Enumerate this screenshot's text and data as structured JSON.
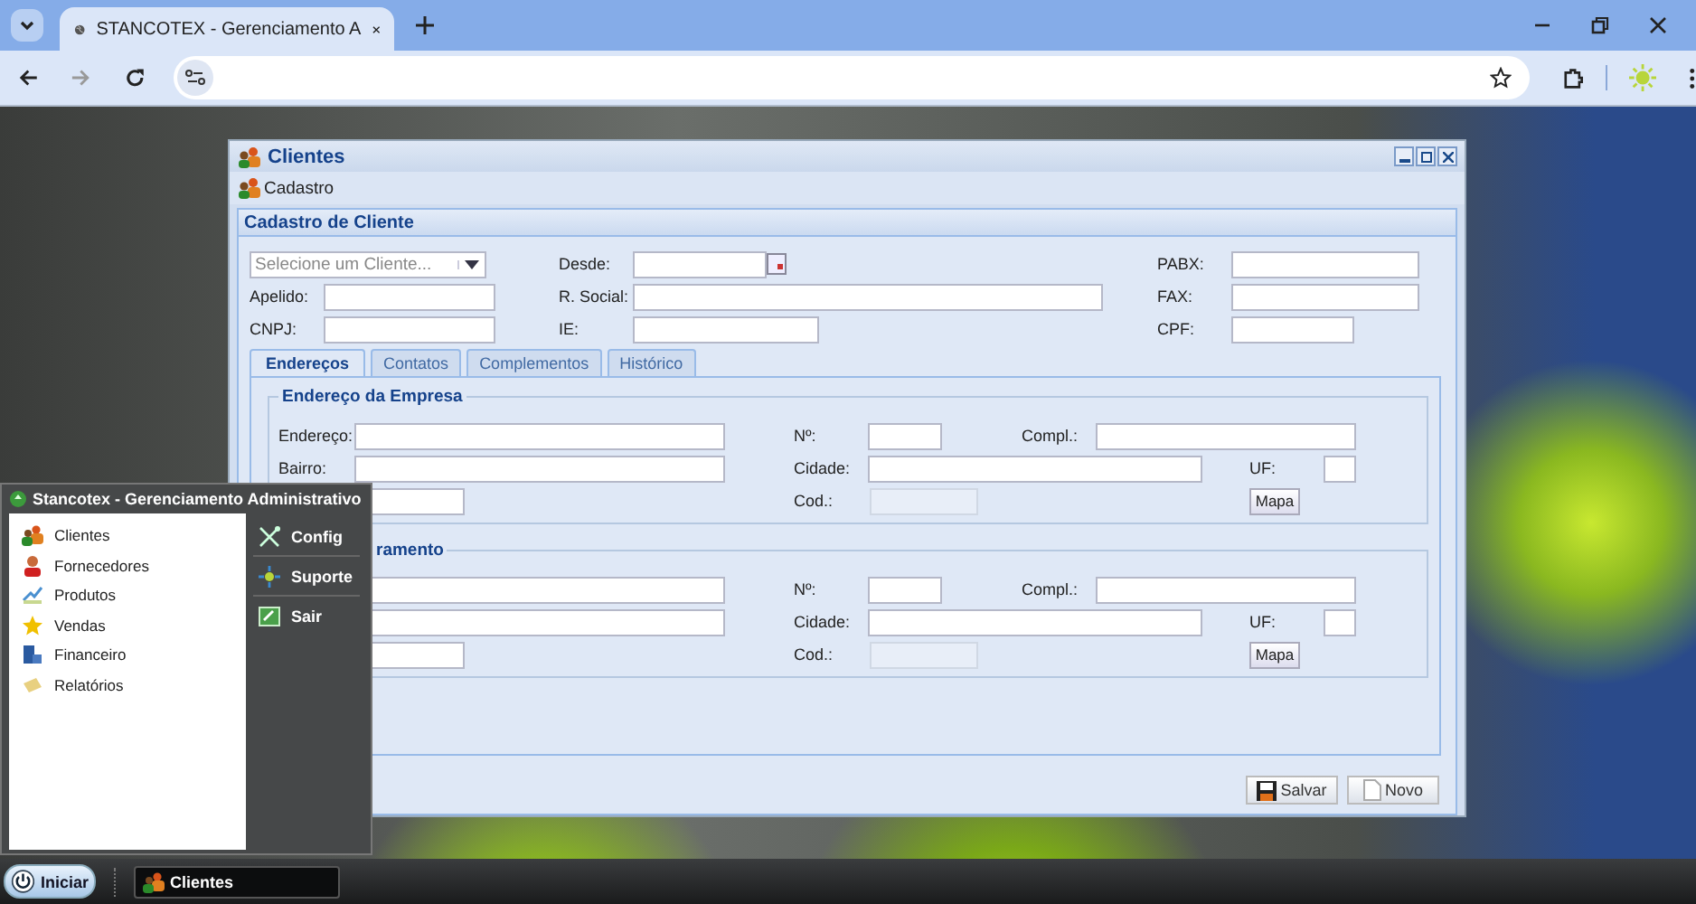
{
  "browser": {
    "tab_title": "STANCOTEX - Gerenciamento A"
  },
  "window": {
    "title": "Clientes",
    "toolbar_button": "Cadastro",
    "panel_title": "Cadastro de Cliente",
    "header_rows": [
      [
        {
          "kind": "combo",
          "placeholder": "Selecione um Cliente..."
        },
        {
          "kind": "date",
          "label": "Desde:"
        },
        {
          "kind": "text",
          "label": "PABX:"
        }
      ],
      [
        {
          "kind": "text",
          "label": "Apelido:"
        },
        {
          "kind": "text",
          "label": "R. Social:"
        },
        {
          "kind": "text",
          "label": "FAX:"
        }
      ],
      [
        {
          "kind": "text",
          "label": "CNPJ:"
        },
        {
          "kind": "text",
          "label": "IE:"
        },
        {
          "kind": "text",
          "label": "CPF:"
        }
      ]
    ],
    "tabs": [
      {
        "label": "Endereços",
        "selected": true
      },
      {
        "label": "Contatos",
        "selected": false
      },
      {
        "label": "Complementos",
        "selected": false
      },
      {
        "label": "Histórico",
        "selected": false
      }
    ],
    "fieldsets": [
      {
        "legend": "Endereço da Empresa",
        "rows": [
          [
            {
              "kind": "text",
              "label": "Endereço:"
            },
            {
              "kind": "text",
              "label": "Nº:"
            },
            {
              "kind": "text",
              "label": "Compl.:"
            }
          ],
          [
            {
              "kind": "text",
              "label": "Bairro:"
            },
            {
              "kind": "text",
              "label": "Cidade:"
            },
            {
              "kind": "text",
              "label": "UF:"
            }
          ],
          [
            {
              "kind": "text"
            },
            {
              "kind": "readonly",
              "label": "Cod.:"
            },
            {
              "kind": "button",
              "label": "Mapa"
            }
          ]
        ]
      },
      {
        "legend": "ramento",
        "rows": [
          [
            {
              "kind": "text"
            },
            {
              "kind": "text",
              "label": "Nº:"
            },
            {
              "kind": "text",
              "label": "Compl.:"
            }
          ],
          [
            {
              "kind": "text"
            },
            {
              "kind": "text",
              "label": "Cidade:"
            },
            {
              "kind": "text",
              "label": "UF:"
            }
          ],
          [
            {
              "kind": "text"
            },
            {
              "kind": "readonly",
              "label": "Cod.:"
            },
            {
              "kind": "button",
              "label": "Mapa"
            }
          ]
        ]
      }
    ],
    "buttons": [
      {
        "label": "Salvar"
      },
      {
        "label": "Novo"
      }
    ]
  },
  "start_menu": {
    "title": "Stancotex - Gerenciamento Administrativo",
    "items": [
      {
        "label": "Clientes"
      },
      {
        "label": "Fornecedores"
      },
      {
        "label": "Produtos"
      },
      {
        "label": "Vendas"
      },
      {
        "label": "Financeiro"
      },
      {
        "label": "Relatórios"
      }
    ],
    "actions": [
      {
        "label": "Config"
      },
      {
        "label": "Suporte"
      },
      {
        "label": "Sair"
      }
    ]
  },
  "taskbar": {
    "start_label": "Iniciar",
    "tasks": [
      {
        "label": "Clientes"
      }
    ]
  }
}
